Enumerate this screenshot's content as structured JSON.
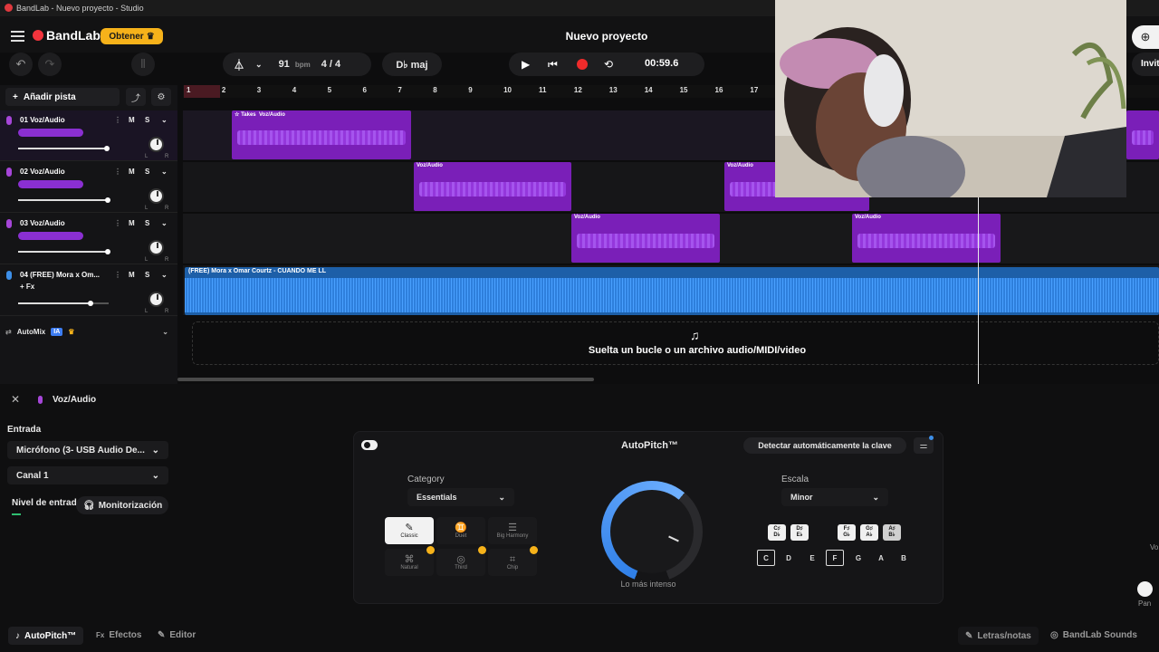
{
  "titlebar": {
    "text": "BandLab - Nuevo proyecto - Studio"
  },
  "header": {
    "logo": "BandLab",
    "obtener": "Obtener",
    "project_title": "Nuevo proyecto"
  },
  "toolbar": {
    "bpm": "91",
    "bpm_unit": "bpm",
    "time_sig": "4 / 4",
    "key": "D♭ maj",
    "time": "00:59.6"
  },
  "right_edge": {
    "invite": "Invit"
  },
  "ruler": {
    "bars": [
      "1",
      "2",
      "3",
      "4",
      "5",
      "6",
      "7",
      "8",
      "9",
      "10",
      "11",
      "12",
      "13",
      "14",
      "15",
      "16",
      "17"
    ]
  },
  "add_track": "Añadir pista",
  "tracks": [
    {
      "name": "01  Voz/Audio",
      "m": "M",
      "s": "S",
      "fx": ""
    },
    {
      "name": "02  Voz/Audio",
      "m": "M",
      "s": "S",
      "fx": ""
    },
    {
      "name": "03  Voz/Audio",
      "m": "M",
      "s": "S",
      "fx": ""
    },
    {
      "name": "04  (FREE) Mora x Om...",
      "m": "M",
      "s": "S",
      "fx": "+ Fx"
    }
  ],
  "automix": {
    "label": "AutoMix",
    "badge": "IA"
  },
  "clips": {
    "takes": "Takes",
    "voz": "Voz/Audio",
    "audio_name": "(FREE) Mora x Omar Courtz - CUANDO ME LL"
  },
  "drop_text": "Suelta un bucle o un archivo audio/MIDI/video",
  "bottom": {
    "track_title": "Voz/Audio",
    "entrada_label": "Entrada",
    "input_device": "Micrófono (3- USB Audio De...",
    "channel": "Canal 1",
    "nivel_label": "Nivel de entrada",
    "monitor_label": "Monitorización"
  },
  "autopitch": {
    "title": "AutoPitch™",
    "detect": "Detectar automáticamente la clave",
    "category_label": "Category",
    "category_value": "Essentials",
    "presets": [
      "Classic",
      "Duet",
      "Big Harmony",
      "Natural",
      "Third",
      "Chip"
    ],
    "dial_label": "Lo más intenso",
    "scale_label": "Escala",
    "scale_value": "Minor",
    "sharp_keys": [
      {
        "top": "C♯",
        "bottom": "D♭"
      },
      {
        "top": "D♯",
        "bottom": "E♭"
      },
      {
        "top": "F♯",
        "bottom": "G♭"
      },
      {
        "top": "G♯",
        "bottom": "A♭"
      },
      {
        "top": "A♯",
        "bottom": "B♭"
      }
    ],
    "notes": [
      "C",
      "D",
      "E",
      "F",
      "G",
      "A",
      "B"
    ]
  },
  "footer": {
    "autopitch": "AutoPitch™",
    "efectos": "Efectos",
    "editor": "Editor",
    "letras": "Letras/notas",
    "sounds": "BandLab Sounds"
  },
  "side_right": {
    "vol": "Vo",
    "pan": "Pan"
  }
}
